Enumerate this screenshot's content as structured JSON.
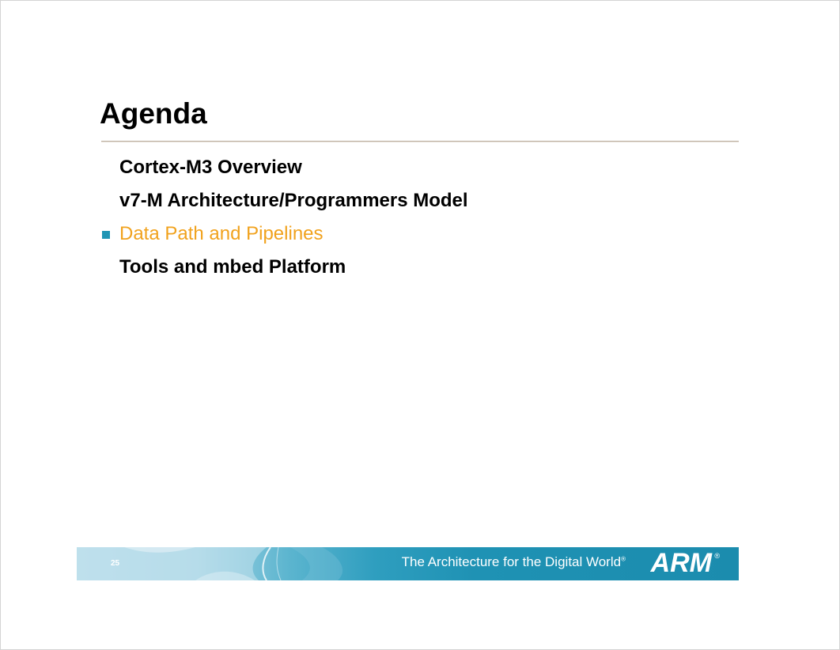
{
  "slide": {
    "title": "Agenda",
    "agenda_items": [
      {
        "label": "Cortex-M3 Overview",
        "active": false
      },
      {
        "label": "v7-M Architecture/Programmers Model",
        "active": false
      },
      {
        "label": "Data Path and Pipelines",
        "active": true
      },
      {
        "label": "Tools and mbed Platform",
        "active": false
      }
    ]
  },
  "footer": {
    "page_number": "25",
    "tagline": "The Architecture for the Digital World",
    "tagline_mark": "®",
    "logo_text": "ARM",
    "logo_mark": "®"
  },
  "colors": {
    "active_item": "#f1a21d",
    "bullet": "#1f95b4",
    "footer_blue": "#1b8cae"
  }
}
